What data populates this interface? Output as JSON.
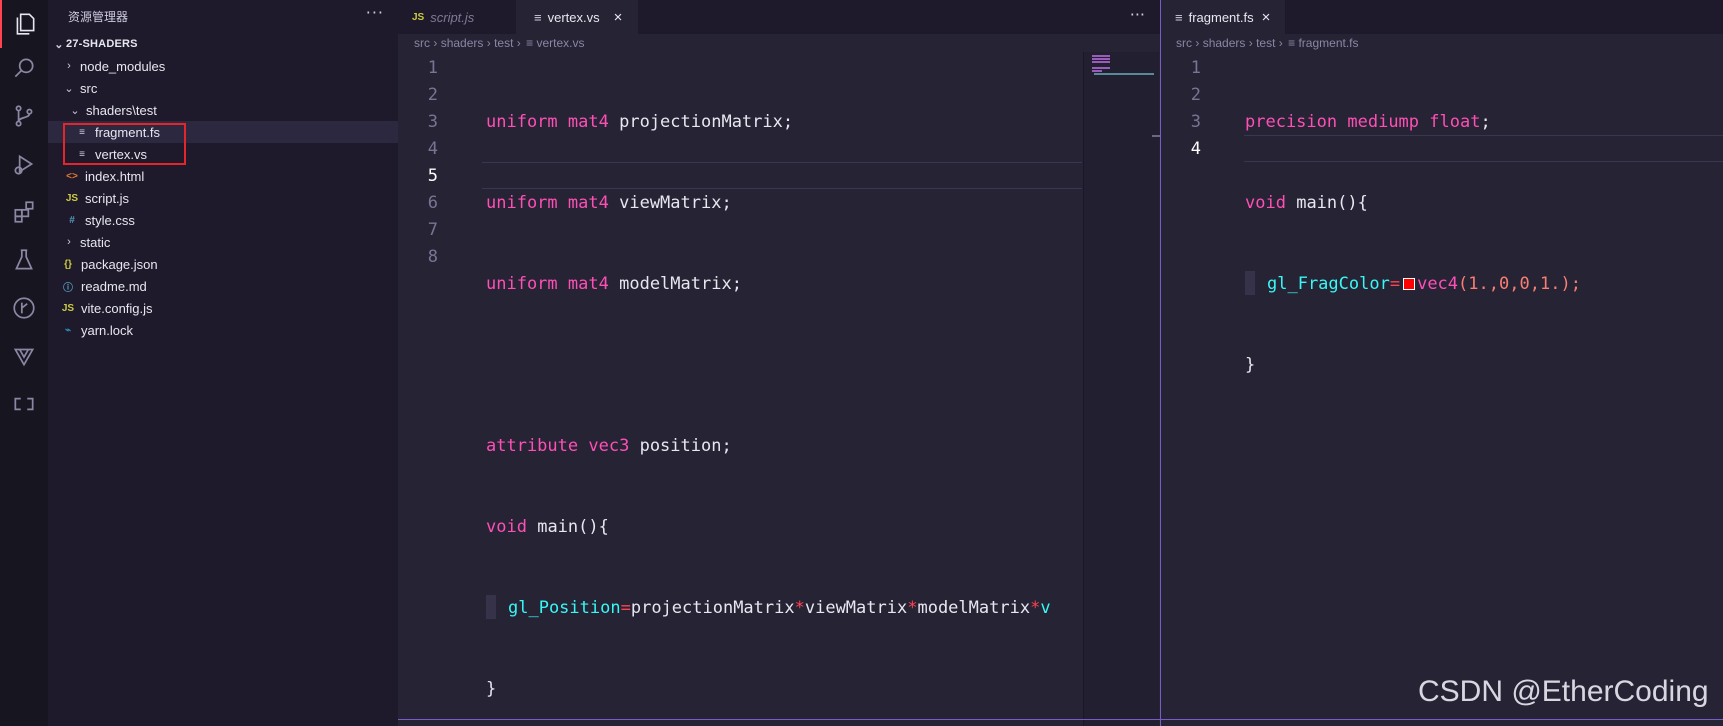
{
  "activity_bar": {
    "items": [
      "explorer-icon",
      "search-icon",
      "source-control-icon",
      "run-debug-icon",
      "extensions-icon",
      "testing-icon",
      "git-graph-icon",
      "deploy-icon",
      "remote-icon"
    ]
  },
  "sidebar": {
    "title": "资源管理器",
    "more": "···",
    "root": "27-SHADERS",
    "tree": [
      {
        "label": "node_modules",
        "chev": "›"
      },
      {
        "label": "src",
        "chev": "⌄"
      },
      {
        "label": "shaders\\test",
        "chev": "⌄"
      },
      {
        "label": "fragment.fs",
        "icon": "≡"
      },
      {
        "label": "vertex.vs",
        "icon": "≡"
      },
      {
        "label": "index.html",
        "icon": "<>"
      },
      {
        "label": "script.js",
        "icon": "JS"
      },
      {
        "label": "style.css",
        "icon": "#"
      },
      {
        "label": "static",
        "chev": "›"
      },
      {
        "label": "package.json",
        "icon": "{}"
      },
      {
        "label": "readme.md",
        "icon": "ⓘ"
      },
      {
        "label": "vite.config.js",
        "icon": "JS"
      },
      {
        "label": "yarn.lock",
        "icon": "🧶"
      }
    ]
  },
  "editor1": {
    "tabs": [
      {
        "label": "script.js",
        "icon": "JS"
      },
      {
        "label": "vertex.vs",
        "icon": "≡",
        "close": "×"
      }
    ],
    "more": "···",
    "breadcrumb": [
      "src",
      "shaders",
      "test",
      "vertex.vs"
    ],
    "separator": "›",
    "line_numbers": [
      "1",
      "2",
      "3",
      "4",
      "5",
      "6",
      "7",
      "8"
    ],
    "lines": [
      {
        "kw": "uniform",
        "ty": "mat4",
        "id": "projectionMatrix",
        "end": ";"
      },
      {
        "kw": "uniform",
        "ty": "mat4",
        "id": "viewMatrix",
        "end": ";"
      },
      {
        "kw": "uniform",
        "ty": "mat4",
        "id": "modelMatrix",
        "end": ";"
      },
      {},
      {
        "kw": "attribute",
        "ty": "vec3",
        "id": "position",
        "end": ";"
      },
      {
        "vo": "void",
        "id": "main(){"
      },
      {
        "fn": "gl_Position",
        "op": "=",
        "a": "projectionMatrix",
        "b": "viewMatrix",
        "c": "modelMatrix",
        "d": "v"
      },
      {
        "id": "}"
      }
    ]
  },
  "editor2": {
    "tabs": [
      {
        "label": "fragment.fs",
        "icon": "≡",
        "close": "×"
      }
    ],
    "breadcrumb": [
      "src",
      "shaders",
      "test",
      "fragment.fs"
    ],
    "separator": "›",
    "line_numbers": [
      "1",
      "2",
      "3",
      "4"
    ],
    "lines": {
      "l1": {
        "kw": "precision",
        "q": "mediump",
        "ty": "float",
        "end": ";"
      },
      "l2": {
        "vo": "void",
        "id": "main(){"
      },
      "l3": {
        "fn": "gl_FragColor",
        "op": "=",
        "call": "vec4",
        "open": "(",
        "n1": "1.",
        "c1": ",",
        "n2": "0",
        "c2": ",",
        "n3": "0",
        "c3": ",",
        "n4": "1.",
        "close": ");"
      },
      "l4": {
        "id": "}"
      }
    },
    "swatch_color": "#ff0000"
  },
  "watermark": "CSDN @EtherCoding"
}
